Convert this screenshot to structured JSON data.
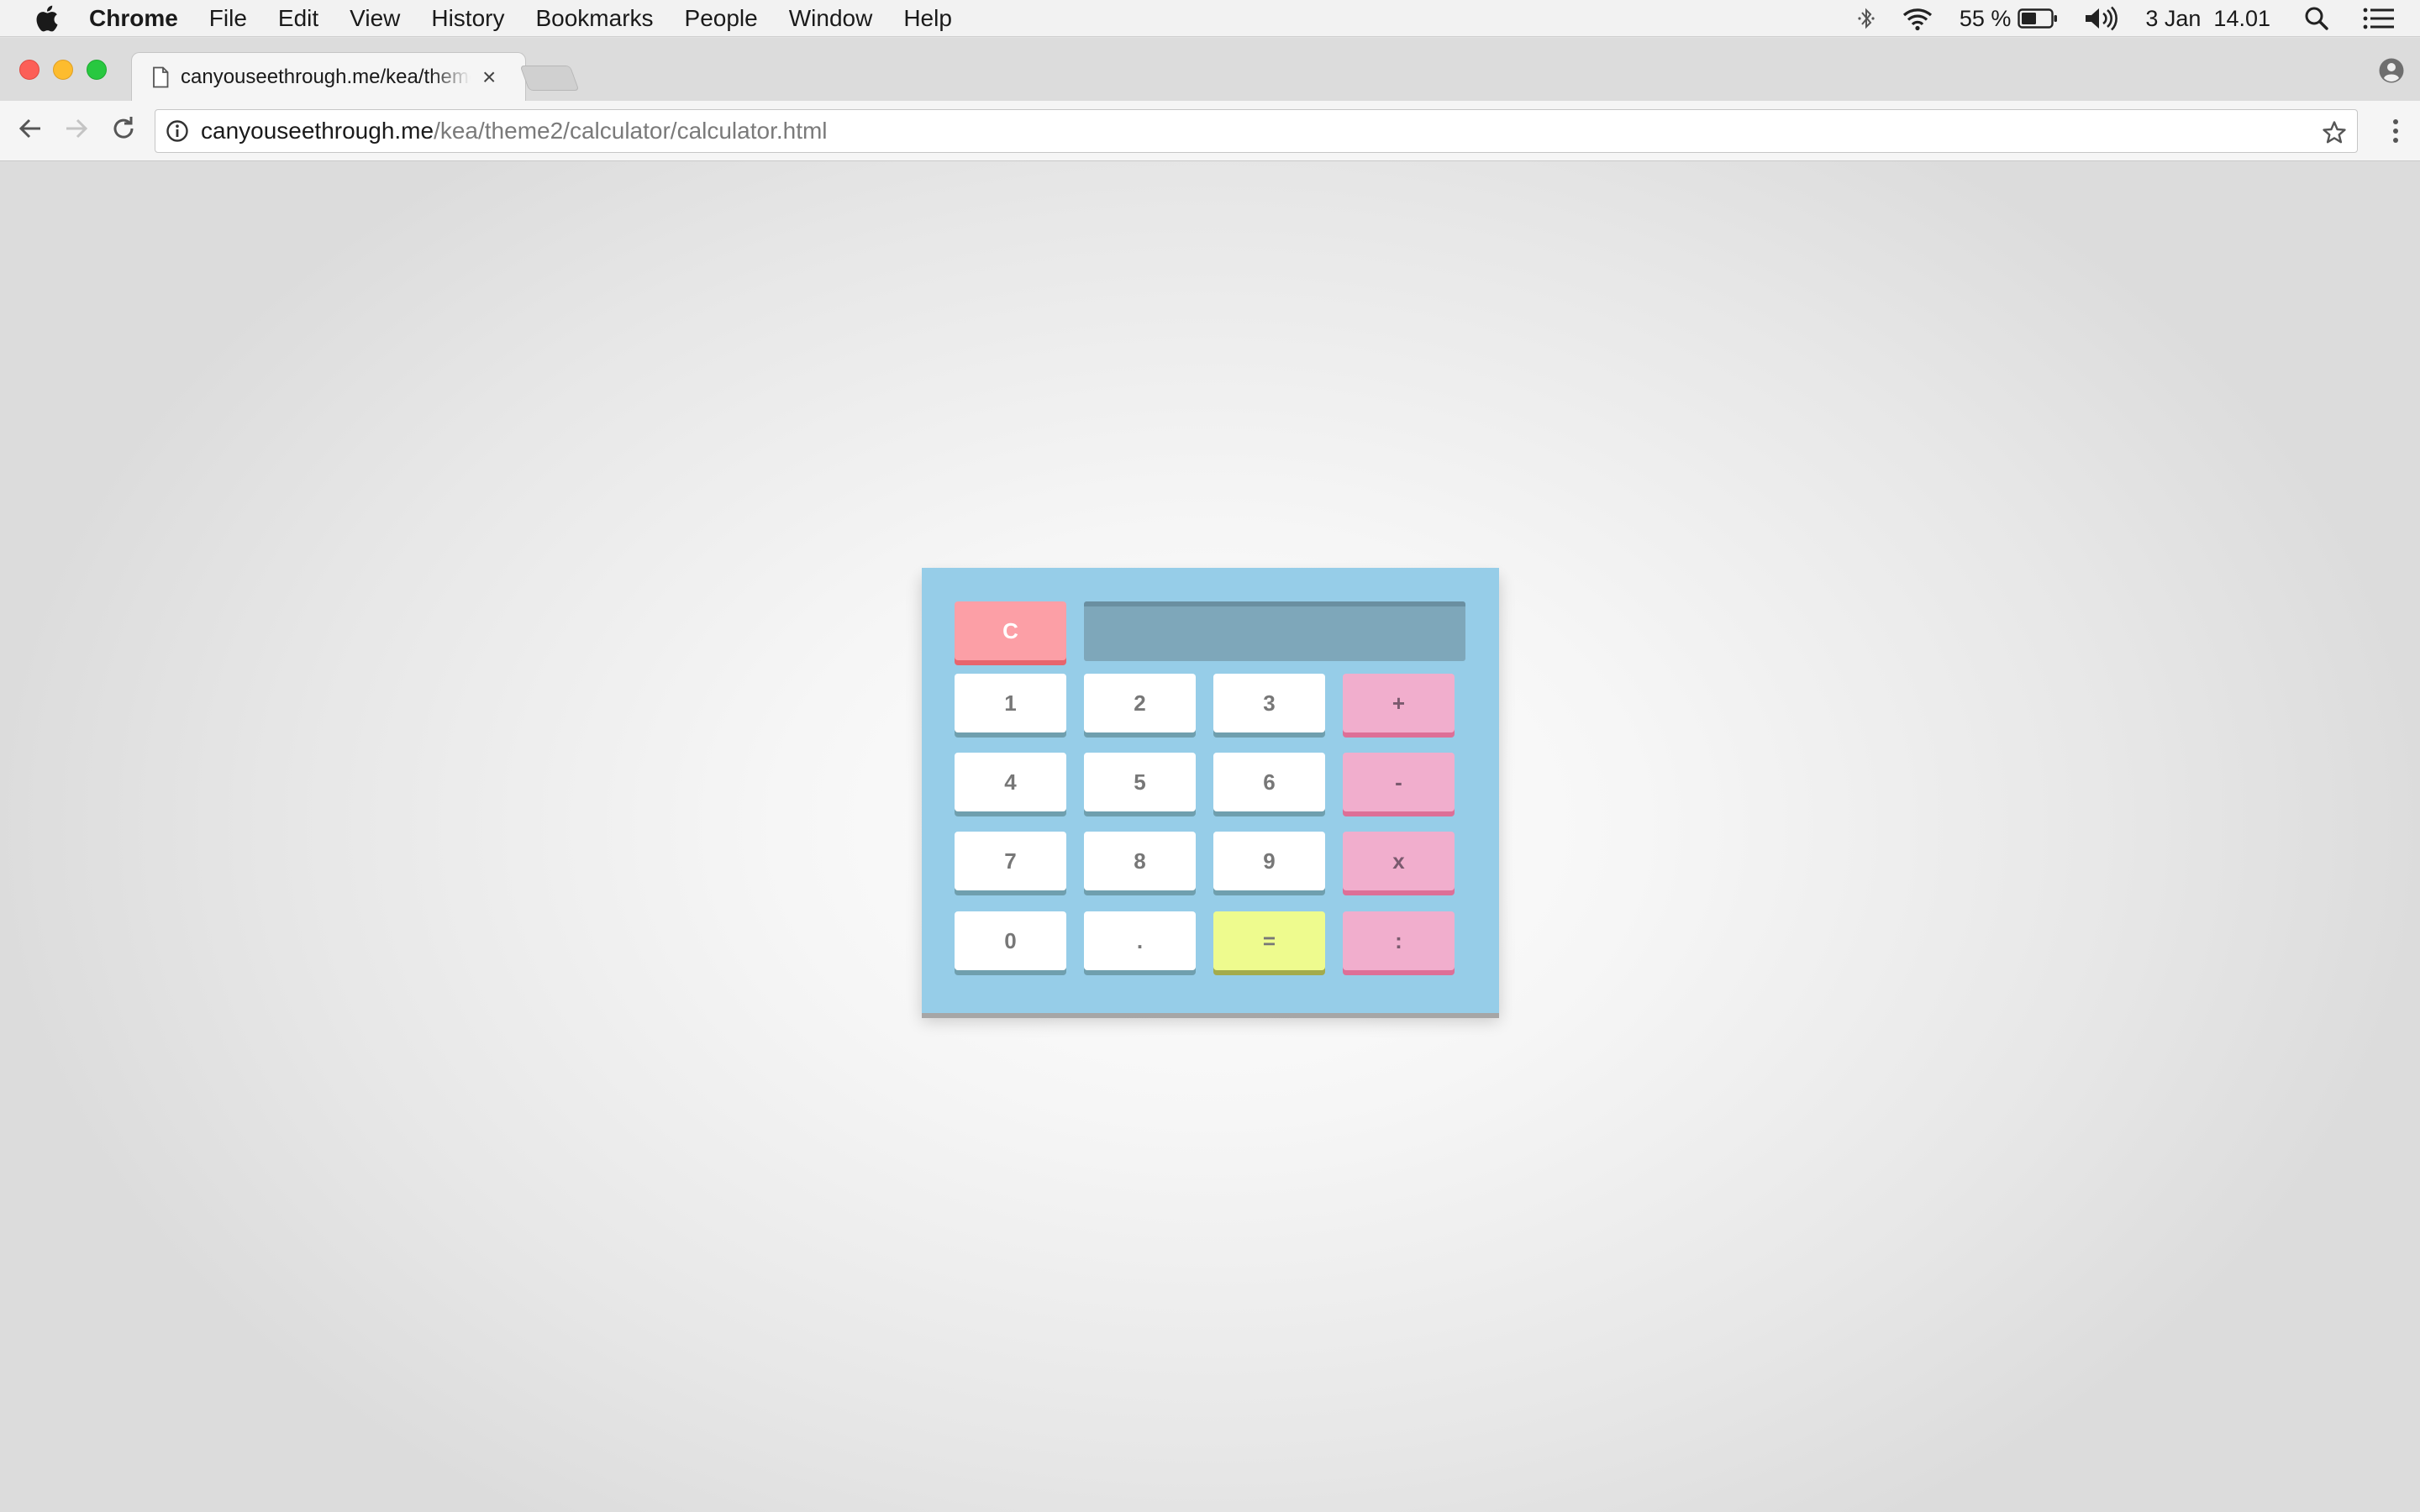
{
  "menubar": {
    "app_name": "Chrome",
    "items": [
      "File",
      "Edit",
      "View",
      "History",
      "Bookmarks",
      "People",
      "Window",
      "Help"
    ],
    "battery_text": "55 %",
    "clock": "3 Jan  14.01"
  },
  "browser": {
    "tab_title": "canyouseethrough.me/kea/theme2/calculator/calculator.html",
    "tab_close": "×",
    "url_host": "canyouseethrough.me",
    "url_path": "/kea/theme2/calculator/calculator.html"
  },
  "calculator": {
    "display_value": "",
    "clear_label": "C",
    "digits": [
      "1",
      "2",
      "3",
      "4",
      "5",
      "6",
      "7",
      "8",
      "9",
      "0"
    ],
    "decimal_label": ".",
    "equals_label": "=",
    "operators": {
      "add": "+",
      "subtract": "-",
      "multiply": "x",
      "divide": ":"
    }
  },
  "colors": {
    "calculator_body": "#96cde8",
    "display": "#7ea7ba",
    "clear_key": "#fc9fa6",
    "operator_key": "#f1aecd",
    "equals_key": "#eefb8e",
    "number_key": "#ffffff"
  },
  "icons": [
    "apple-logo-icon",
    "bluetooth-icon",
    "wifi-icon",
    "battery-icon",
    "volume-icon",
    "spotlight-search-icon",
    "notification-center-icon",
    "page-icon",
    "close-icon",
    "profile-icon",
    "back-arrow-icon",
    "forward-arrow-icon",
    "reload-icon",
    "info-icon",
    "bookmark-star-icon",
    "menu-kebab-icon"
  ]
}
